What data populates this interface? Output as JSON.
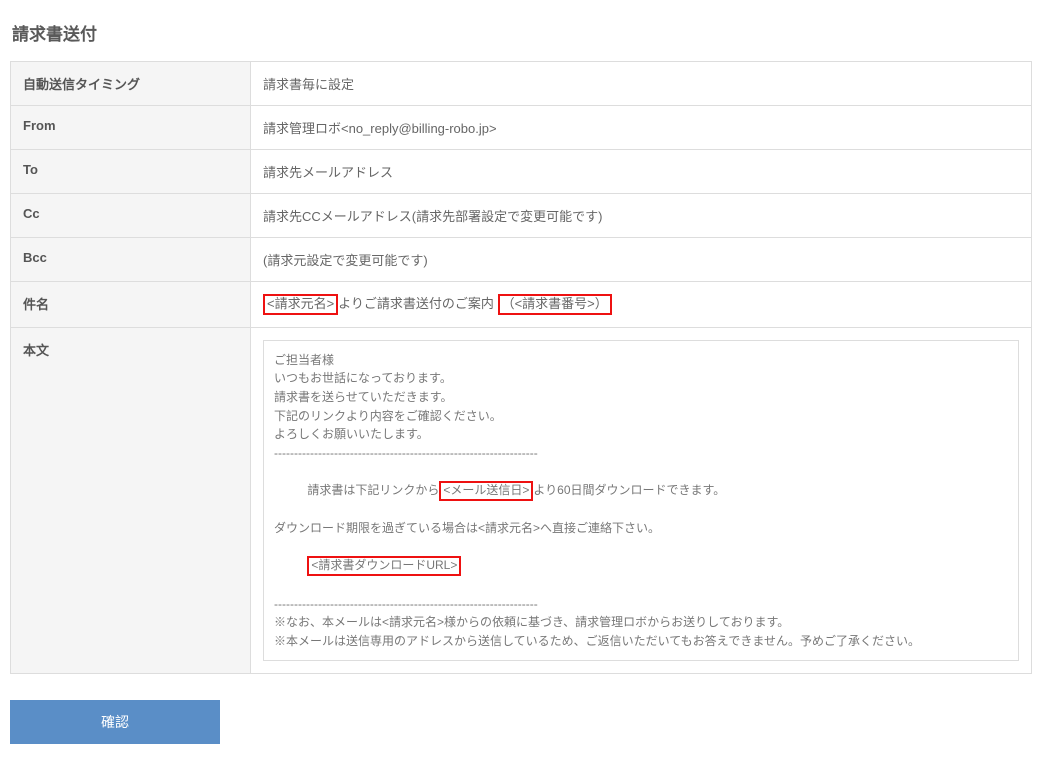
{
  "page_title": "請求書送付",
  "rows": {
    "timing": {
      "label": "自動送信タイミング",
      "value": "請求書毎に設定"
    },
    "from": {
      "label": "From",
      "value": "請求管理ロボ<no_reply@billing-robo.jp>"
    },
    "to": {
      "label": "To",
      "value": "請求先メールアドレス"
    },
    "cc": {
      "label": "Cc",
      "value": "請求先CCメールアドレス(請求先部署設定で変更可能です)"
    },
    "bcc": {
      "label": "Bcc",
      "value": "(請求元設定で変更可能です)"
    },
    "subject": {
      "label": "件名"
    },
    "body": {
      "label": "本文"
    }
  },
  "subject_parts": {
    "p1_hl": "<請求元名>",
    "p2": "よりご請求書送付のご案内",
    "p3_hl": "（<請求書番号>）"
  },
  "body_text": {
    "l01": "ご担当者様",
    "l02": "",
    "l03": "いつもお世話になっております。",
    "l04": "請求書を送らせていただきます。",
    "l05": "下記のリンクより内容をご確認ください。",
    "l06": "よろしくお願いいたします。",
    "l07": "------------------------------------------------------------------",
    "l08_a": "請求書は下記リンクから",
    "l08_b_hl": "<メール送信日>",
    "l08_c": "より60日間ダウンロードできます。",
    "l09": "ダウンロード期限を過ぎている場合は<請求元名>へ直接ご連絡下さい。",
    "l10_hl": "<請求書ダウンロードURL>",
    "l11": "------------------------------------------------------------------",
    "l12": "※なお、本メールは<請求元名>様からの依頼に基づき、請求管理ロボからお送りしております。",
    "l13": "※本メールは送信専用のアドレスから送信しているため、ご返信いただいてもお答えできません。予めご了承ください。"
  },
  "buttons": {
    "confirm": "確認"
  }
}
